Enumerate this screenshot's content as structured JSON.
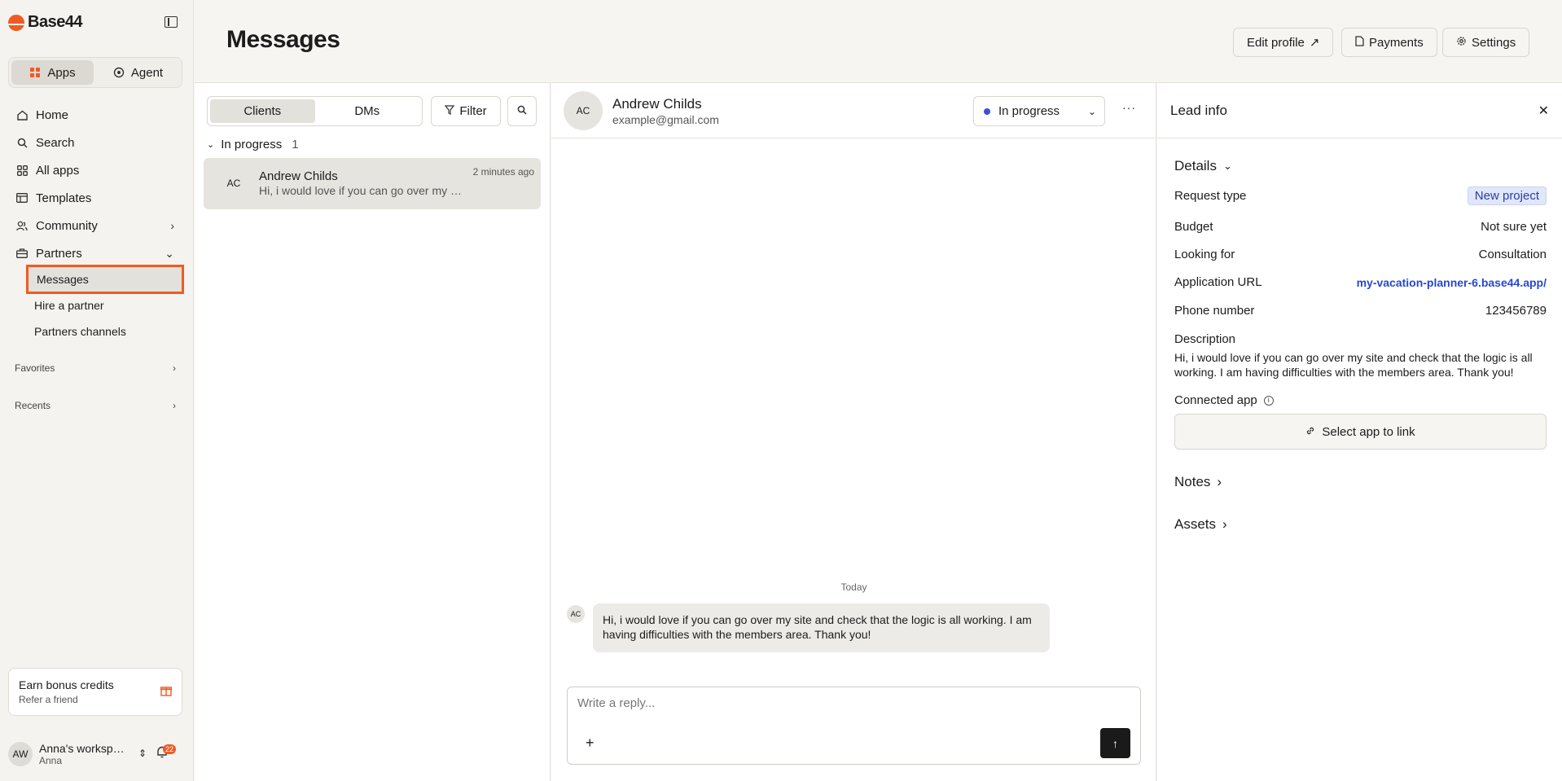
{
  "app": {
    "name": "Base44"
  },
  "sidebar": {
    "mode_tabs": [
      {
        "label": "Apps"
      },
      {
        "label": "Agent"
      }
    ],
    "nav": [
      {
        "label": "Home"
      },
      {
        "label": "Search"
      },
      {
        "label": "All apps"
      },
      {
        "label": "Templates"
      },
      {
        "label": "Community"
      },
      {
        "label": "Partners"
      }
    ],
    "partners_sub": [
      {
        "label": "Messages"
      },
      {
        "label": "Hire a partner"
      },
      {
        "label": "Partners channels"
      }
    ],
    "favorites_label": "Favorites",
    "recents_label": "Recents",
    "earn": {
      "title": "Earn bonus credits",
      "subtitle": "Refer a friend"
    },
    "workspace": {
      "initials": "AW",
      "name": "Anna's worksp…",
      "user": "Anna",
      "notifications": "22"
    }
  },
  "header": {
    "title": "Messages",
    "buttons": {
      "edit_profile": "Edit profile",
      "payments": "Payments",
      "settings": "Settings"
    }
  },
  "list": {
    "tabs": {
      "clients": "Clients",
      "dms": "DMs"
    },
    "filter_label": "Filter",
    "group": {
      "label": "In progress",
      "count": "1"
    },
    "conversations": [
      {
        "initials": "AC",
        "name": "Andrew Childs",
        "preview": "Hi, i would love if you can go over my site and check that the logic is all working.",
        "time": "2 minutes ago"
      }
    ]
  },
  "chat": {
    "contact": {
      "initials": "AC",
      "name": "Andrew Childs",
      "email": "example@gmail.com"
    },
    "status": "In progress",
    "status_color": "#3b4fd8",
    "day_label": "Today",
    "messages": [
      {
        "initials": "AC",
        "text": "Hi, i would love if you can go over my site and check that the logic is all working. I am having difficulties with the members area. Thank you!"
      }
    ],
    "reply_placeholder": "Write a reply..."
  },
  "lead": {
    "title": "Lead info",
    "details_label": "Details",
    "fields": {
      "request_type": {
        "label": "Request type",
        "value": "New project"
      },
      "budget": {
        "label": "Budget",
        "value": "Not sure yet"
      },
      "looking_for": {
        "label": "Looking for",
        "value": "Consultation"
      },
      "app_url": {
        "label": "Application URL",
        "value": "my-vacation-planner-6.base44.app/"
      },
      "phone": {
        "label": "Phone number",
        "value": "123456789"
      }
    },
    "description_label": "Description",
    "description": "Hi, i would love if you can go over my site and check that the logic is all working. I am having difficulties with the members area. Thank you!",
    "connected_app_label": "Connected app",
    "select_app_label": "Select app to link",
    "notes_label": "Notes",
    "assets_label": "Assets"
  },
  "colors": {
    "accent": "#f15a22",
    "link": "#2647d6"
  }
}
